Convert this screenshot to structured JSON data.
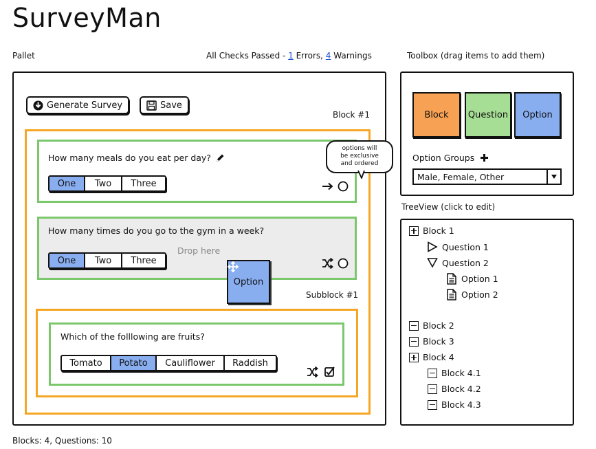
{
  "app": {
    "title": "SurveyMan"
  },
  "pallet": {
    "label": "Pallet",
    "checks": {
      "prefix": "All Checks Passed - ",
      "errors_count": "1",
      "errors_label": " Errors, ",
      "warnings_count": "4",
      "warnings_label": " Warnings"
    },
    "generate_button": "Generate Survey",
    "save_button": "Save",
    "block_label": "Block #1",
    "subblock_label": "Subblock #1",
    "drop_hint": "Drop here",
    "dragging_item": "Option",
    "questions": [
      {
        "text": "How many meals do you eat per day?",
        "options": [
          "One",
          "Two",
          "Three"
        ],
        "selected": 0,
        "order_icon": "arrow-right-icon",
        "type_icon": "radio-circle-icon"
      },
      {
        "text": "How many times do you go to the gym in a week?",
        "options": [
          "One",
          "Two",
          "Three"
        ],
        "selected": 0,
        "order_icon": "shuffle-icon",
        "type_icon": "radio-circle-icon"
      },
      {
        "text": "Which of the folllowing are fruits?",
        "options": [
          "Tomato",
          "Potato",
          "Cauliflower",
          "Raddish"
        ],
        "selected": 1,
        "order_icon": "shuffle-icon",
        "type_icon": "checkbox-icon"
      }
    ],
    "tooltip": [
      "options will",
      "be exclusive",
      "and ordered"
    ]
  },
  "toolbox": {
    "label": "Toolbox (drag items to add them)",
    "items": [
      "Block",
      "Question",
      "Option"
    ],
    "colors": {
      "block": "#f7a154",
      "question": "#a7de95",
      "option": "#89aef0"
    },
    "option_groups_label": "Option Groups",
    "option_groups_value": "Male, Female, Other"
  },
  "treeview": {
    "label": "TreeView (click to edit)",
    "items": [
      {
        "label": "Block 1",
        "icon": "plus-box-icon"
      },
      {
        "label": "Question 1",
        "icon": "triangle-right-icon"
      },
      {
        "label": "Question 2",
        "icon": "triangle-down-icon"
      },
      {
        "label": "Option 1",
        "icon": "document-icon"
      },
      {
        "label": "Option 2",
        "icon": "document-icon"
      },
      {
        "label": "Block 2",
        "icon": "minus-box-icon"
      },
      {
        "label": "Block 3",
        "icon": "minus-box-icon"
      },
      {
        "label": "Block 4",
        "icon": "plus-box-icon"
      },
      {
        "label": "Block 4.1",
        "icon": "minus-box-icon"
      },
      {
        "label": "Block 4.2",
        "icon": "minus-box-icon"
      },
      {
        "label": "Block 4.3",
        "icon": "minus-box-icon"
      }
    ]
  },
  "footer": {
    "status": "Blocks: 4, Questions: 10"
  }
}
